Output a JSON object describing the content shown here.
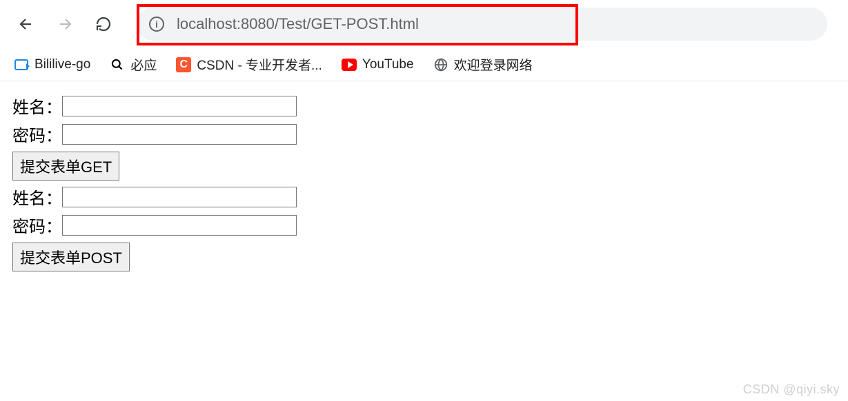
{
  "address_bar": {
    "url_display": "localhost:8080/Test/GET-POST.html",
    "host": "localhost",
    "port_path": ":8080/Test/GET-POST.html"
  },
  "bookmarks": [
    {
      "label": "Bililive-go"
    },
    {
      "label": "必应"
    },
    {
      "label": "CSDN - 专业开发者..."
    },
    {
      "label": "YouTube"
    },
    {
      "label": "欢迎登录网络"
    }
  ],
  "form_get": {
    "name_label": "姓名：",
    "password_label": "密码：",
    "submit_label": "提交表单GET",
    "name_value": "",
    "password_value": ""
  },
  "form_post": {
    "name_label": "姓名：",
    "password_label": "密码：",
    "submit_label": "提交表单POST",
    "name_value": "",
    "password_value": ""
  },
  "watermark": "CSDN @qiyi.sky"
}
